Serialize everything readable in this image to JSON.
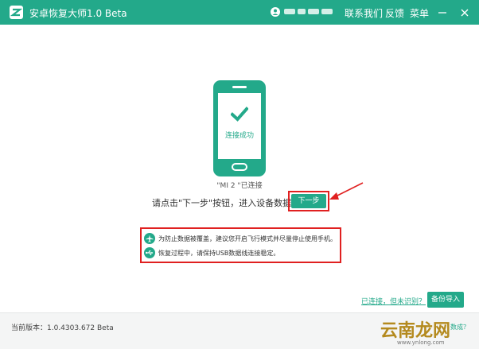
{
  "app": {
    "title": "安卓恢复大师1.0 Beta"
  },
  "header": {
    "nav": {
      "contact": "联系我们",
      "feedback": "反馈",
      "menu": "菜单"
    }
  },
  "device": {
    "connected_label": "连接成功",
    "status": "\"MI 2 \"已连接"
  },
  "instruction": {
    "text": "请点击\"下一步\"按钮，进入设备数据扫描",
    "next_button": "下一步"
  },
  "tips": [
    {
      "icon": "airplane-icon",
      "text": "为防止数据被覆盖，建议您开启飞行模式并尽量停止使用手机。"
    },
    {
      "icon": "usb-icon",
      "text": "恢复过程中，请保持USB数据线连接稳定。"
    }
  ],
  "bottom": {
    "help_link": "已连接，但未识别？",
    "backup_button": "备份导入"
  },
  "footer": {
    "version": "当前版本：1.0.4303.672 Beta",
    "watermark": "云南龙网",
    "watermark_small": "www.ynlong.com",
    "trailing_link": "数成？"
  },
  "colors": {
    "accent": "#23a98a",
    "highlight": "#e02020"
  }
}
